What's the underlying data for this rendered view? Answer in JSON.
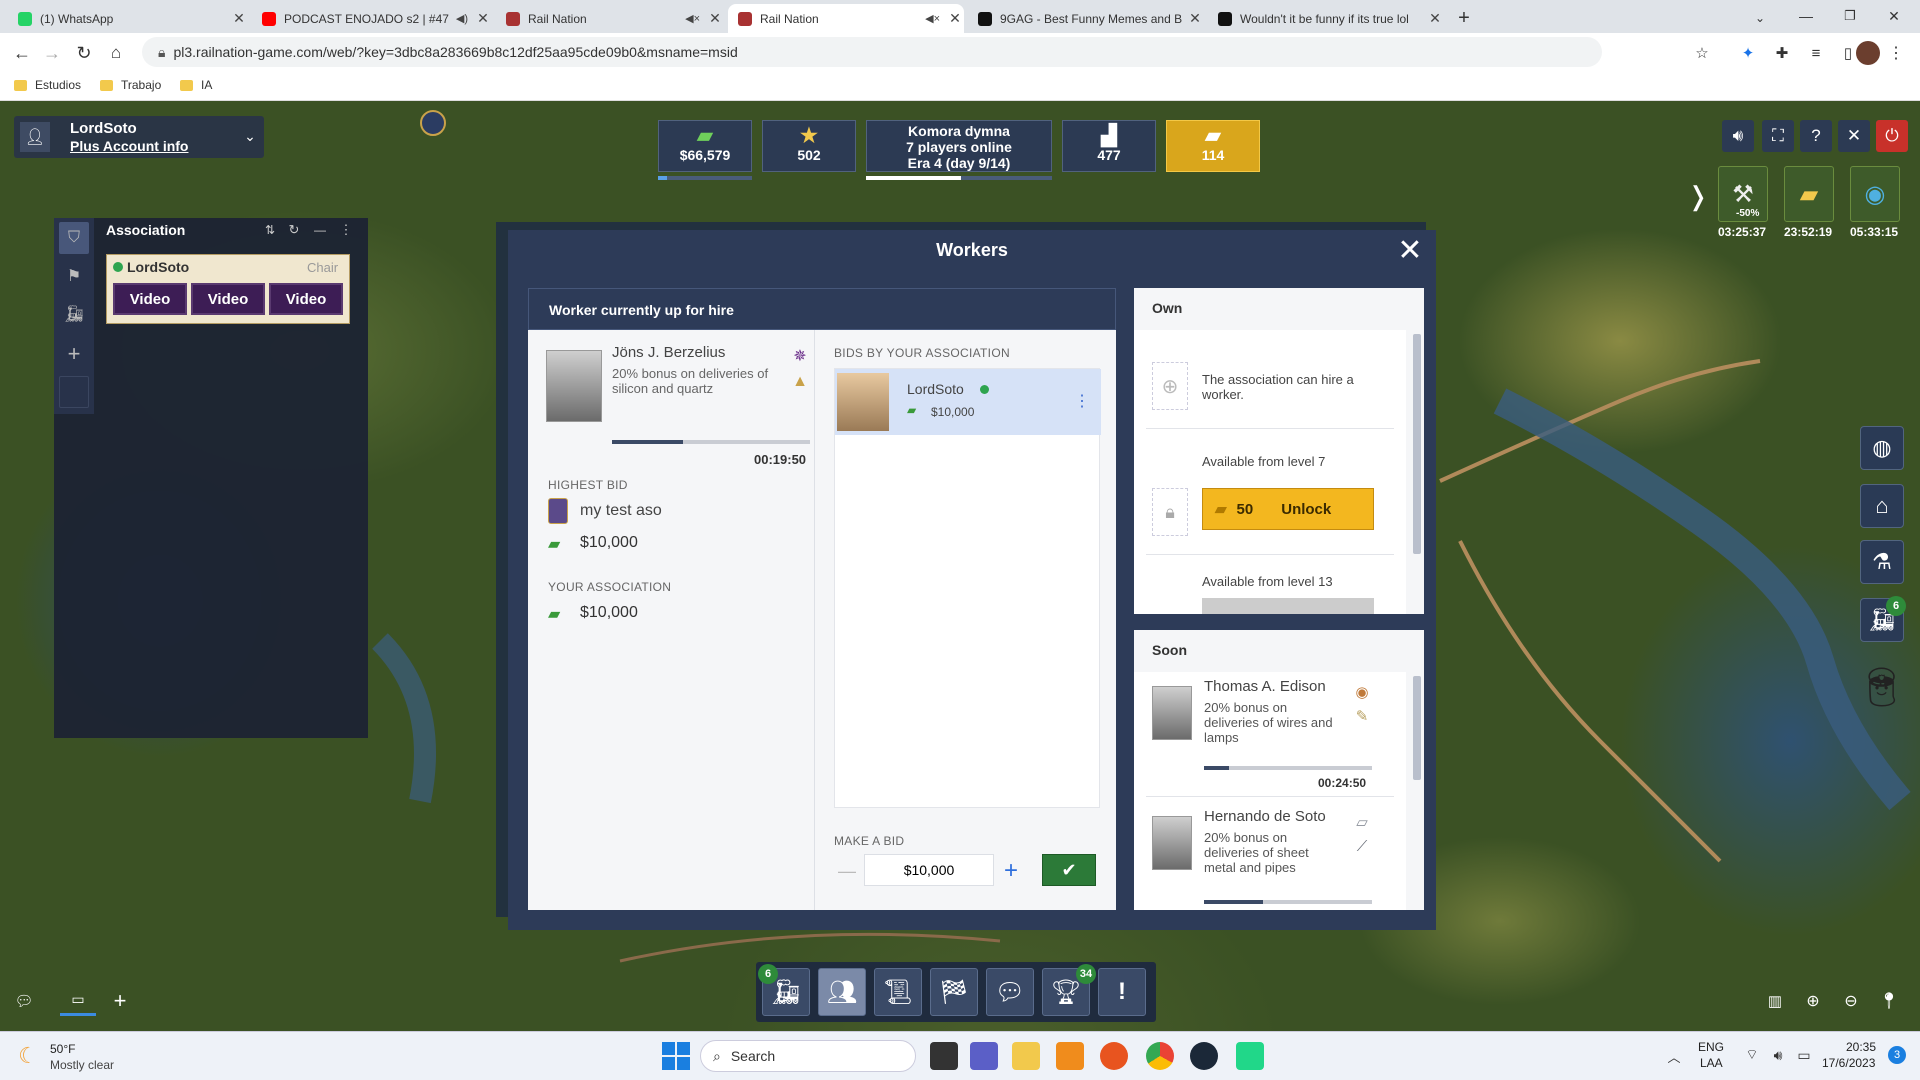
{
  "browser": {
    "tabs": [
      {
        "title": "(1) WhatsApp",
        "icon": "whatsapp-icon",
        "color": "#25d366"
      },
      {
        "title": "PODCAST ENOJADO s2 | #47",
        "icon": "youtube-icon",
        "color": "#ff0000"
      },
      {
        "title": "Rail Nation",
        "icon": "railnation-icon",
        "color": "#a83232"
      },
      {
        "title": "Rail Nation",
        "icon": "railnation-icon",
        "color": "#a83232"
      },
      {
        "title": "9GAG - Best Funny Memes and B",
        "icon": "9gag-icon",
        "color": "#111111"
      },
      {
        "title": "Wouldn't it be funny if its true lol",
        "icon": "9gag-icon",
        "color": "#111111"
      }
    ],
    "url": "pl3.railnation-game.com/web/?key=3dbc8a283669b8c12df25aa95cde09b0&msname=msid",
    "bookmarks": [
      "Estudios",
      "Trabajo",
      "IA"
    ]
  },
  "account": {
    "name": "LordSoto",
    "subtitle": "Plus Account info"
  },
  "resources": {
    "money": "$66,579",
    "prestige": "502",
    "server_name": "Komora dymna",
    "players_online": "7 players online",
    "era": "Era 4 (day 9/14)",
    "rank": "477",
    "gold": "114"
  },
  "timers": {
    "t1_label": "-50%",
    "t1": "03:25:37",
    "t2": "23:52:19",
    "t3": "05:33:15"
  },
  "association_panel": {
    "title": "Association",
    "member": "LordSoto",
    "role": "Chair",
    "video_buttons": [
      "Video",
      "Video",
      "Video"
    ]
  },
  "modal": {
    "title": "Workers",
    "hire_header": "Worker currently up for hire",
    "worker": {
      "name": "Jöns J. Berzelius",
      "bonus": "20% bonus on deliveries of silicon and quartz",
      "timer": "00:19:50",
      "progress": 0.36
    },
    "highest_bid_label": "HIGHEST BID",
    "highest_bidder": "my test aso",
    "highest_bid": "$10,000",
    "your_assoc_label": "YOUR ASSOCIATION",
    "your_assoc_bid": "$10,000",
    "bids_label": "BIDS BY YOUR ASSOCIATION",
    "bid_entry": {
      "name": "LordSoto",
      "amount": "$10,000"
    },
    "make_bid_label": "MAKE A BID",
    "bid_value": "$10,000",
    "own": {
      "title": "Own",
      "can_hire": "The association can hire a worker.",
      "level7": "Available from level 7",
      "unlock_cost": "50",
      "unlock_label": "Unlock",
      "level13": "Available from level 13"
    },
    "soon": {
      "title": "Soon",
      "workers": [
        {
          "name": "Thomas A. Edison",
          "bonus": "20% bonus on deliveries of wires and lamps",
          "timer": "00:24:50",
          "progress": 0.15
        },
        {
          "name": "Hernando de Soto",
          "bonus": "20% bonus on deliveries of sheet metal and pipes",
          "progress": 0.35
        }
      ]
    }
  },
  "bottom_bar": {
    "badge_trains": "6",
    "badge_trophy": "34"
  },
  "side_badge": "6",
  "taskbar": {
    "temp": "50°F",
    "weather": "Mostly clear",
    "search": "Search",
    "lang1": "ENG",
    "lang2": "LAA",
    "time": "20:35",
    "date": "17/6/2023",
    "notif": "3"
  }
}
